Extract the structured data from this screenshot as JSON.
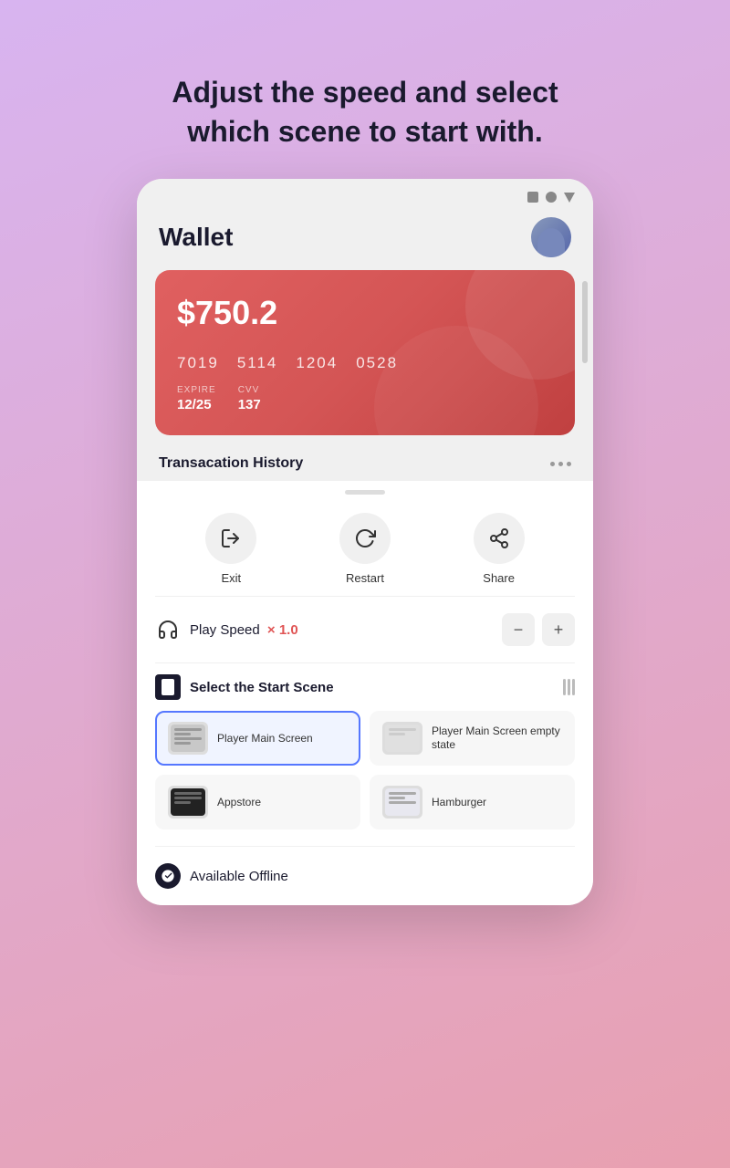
{
  "headline": {
    "line1": "Adjust the speed and select",
    "line2": "which scene to start with."
  },
  "phone": {
    "topbar": {
      "icons": [
        "square",
        "circle",
        "triangle"
      ]
    },
    "wallet": {
      "title": "Wallet",
      "card": {
        "balance": "$750.2",
        "number_parts": [
          "7019",
          "5114",
          "1204",
          "0528"
        ],
        "expire_label": "EXPIRE",
        "expire_value": "12/25",
        "cvv_label": "CVV",
        "cvv_value": "137"
      },
      "transaction_title": "Transacation History"
    }
  },
  "bottom_sheet": {
    "actions": [
      {
        "id": "exit",
        "label": "Exit"
      },
      {
        "id": "restart",
        "label": "Restart"
      },
      {
        "id": "share",
        "label": "Share"
      }
    ],
    "speed": {
      "label": "Play Speed",
      "value": "× 1.0",
      "minus": "−",
      "plus": "+"
    },
    "scene": {
      "title": "Select the Start Scene",
      "items": [
        {
          "id": "player-main",
          "label": "Player Main Screen",
          "selected": true
        },
        {
          "id": "player-empty",
          "label": "Player Main Screen empty state",
          "selected": false
        },
        {
          "id": "appstore",
          "label": "Appstore",
          "selected": false
        },
        {
          "id": "hamburger",
          "label": "Hamburger",
          "selected": false
        }
      ]
    },
    "offline": {
      "label": "Available Offline"
    }
  }
}
